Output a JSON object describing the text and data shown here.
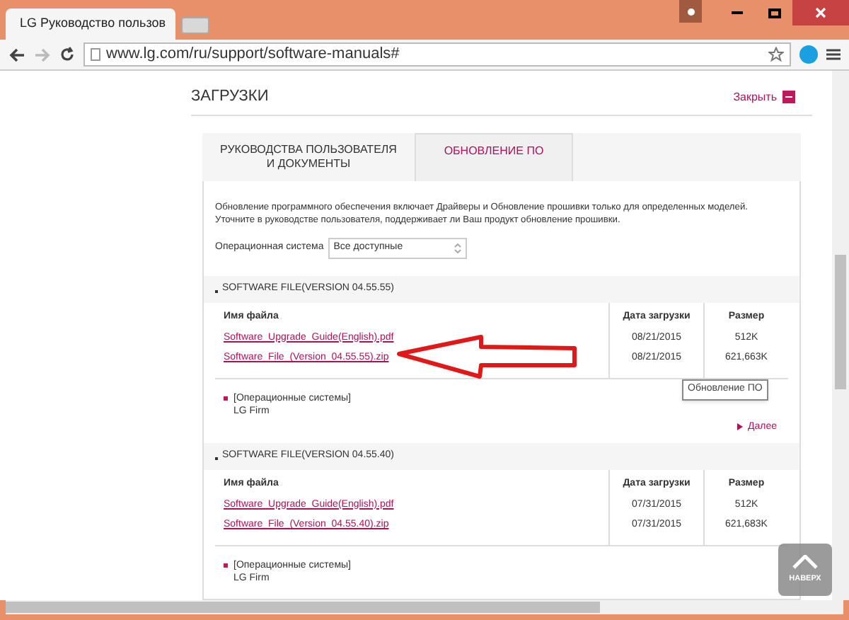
{
  "browser": {
    "tab_title": "LG Руководство пользов",
    "url": "www.lg.com/ru/support/software-manuals#"
  },
  "page": {
    "title": "ЗАГРУЗКИ",
    "close_label": "Закрыть",
    "tabs": [
      {
        "label": "РУКОВОДСТВА ПОЛЬЗОВАТЕЛЯ И ДОКУМЕНТЫ",
        "selected": false
      },
      {
        "label": "ОБНОВЛЕНИЕ ПО",
        "selected": true
      }
    ],
    "description": "Обновление программного обеспечения включает Драйверы и Обновление прошивки только для определенных моделей. Уточните в руководстве пользователя, поддерживает ли Ваш продукт обновление прошивки.",
    "os_label": "Операционная система",
    "os_value": "Все доступные",
    "sections": [
      {
        "title": "SOFTWARE FILE(VERSION 04.55.55)",
        "columns": [
          "Имя файла",
          "Дата загрузки",
          "Размер"
        ],
        "rows": [
          [
            "Software_Upgrade_Guide(English).pdf",
            "08/21/2015",
            "512K"
          ],
          [
            "Software_File_(Version_04.55.55).zip",
            "08/21/2015",
            "621,663K"
          ]
        ],
        "os_heading": "[Операционные системы]",
        "os_name": "LG Firm",
        "more": "Далее"
      },
      {
        "title": "SOFTWARE FILE(VERSION 04.55.40)",
        "columns": [
          "Имя файла",
          "Дата загрузки",
          "Размер"
        ],
        "rows": [
          [
            "Software_Upgrade_Guide(English).pdf",
            "07/31/2015",
            "512K"
          ],
          [
            "Software_File_(Version_04.55.40).zip",
            "07/31/2015",
            "621,683K"
          ]
        ],
        "os_heading": "[Операционные системы]",
        "os_name": "LG Firm"
      }
    ],
    "tooltip": "Обновление ПО",
    "top_button": "НАВЕРХ"
  }
}
